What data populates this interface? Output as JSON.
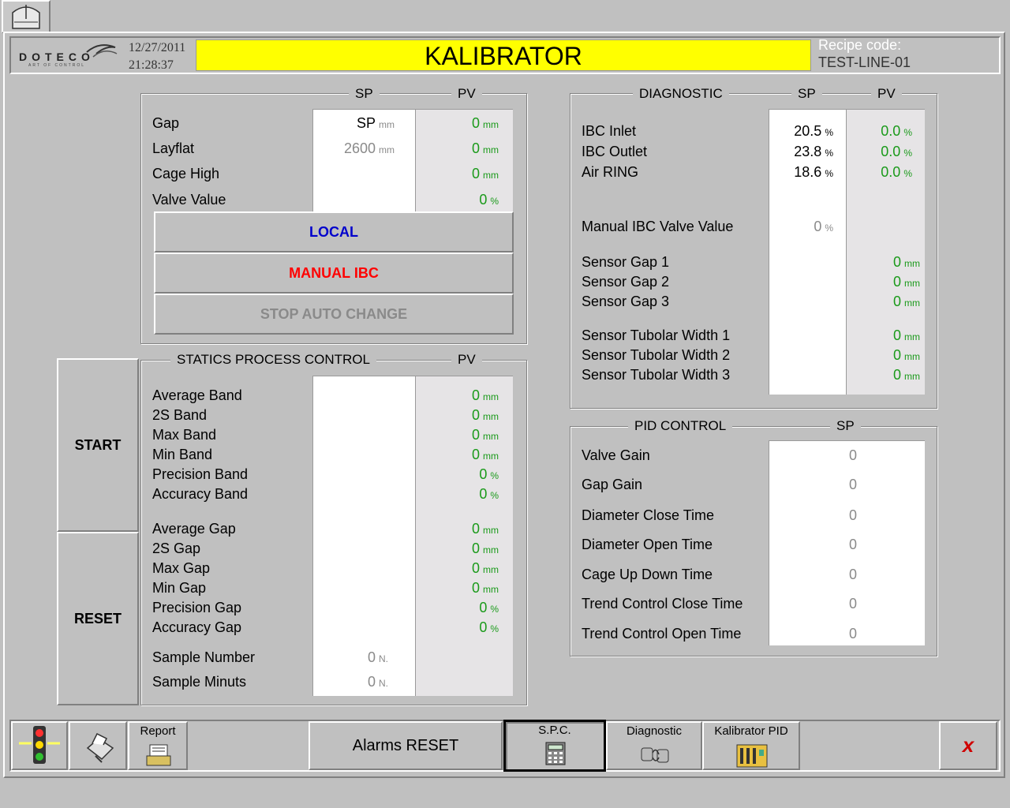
{
  "header": {
    "brand": "DOTECO",
    "brand_tagline": "ART OF CONTROL",
    "date": "12/27/2011",
    "time": "21:28:37",
    "title": "KALIBRATOR",
    "recipe_label": "Recipe code:",
    "recipe_value": "TEST-LINE-01"
  },
  "main": {
    "col_sp": "SP",
    "col_pv": "PV",
    "rows": [
      {
        "label": "Gap",
        "sp": "SP",
        "sp_unit": "mm",
        "pv": "0",
        "pv_unit": "mm"
      },
      {
        "label": "Layflat",
        "sp": "2600",
        "sp_unit": "mm",
        "pv": "0",
        "pv_unit": "mm"
      },
      {
        "label": "Cage High",
        "pv": "0",
        "pv_unit": "mm"
      },
      {
        "label": "Valve Value",
        "pv": "0",
        "pv_unit": "%"
      }
    ],
    "buttons": {
      "local": "LOCAL",
      "manual_ibc": "MANUAL IBC",
      "stop_auto": "STOP AUTO CHANGE"
    }
  },
  "side_buttons": {
    "start": "START",
    "reset": "RESET"
  },
  "statics": {
    "title": "STATICS PROCESS CONTROL",
    "col_pv": "PV",
    "rows": [
      {
        "label": "Average Band",
        "pv": "0",
        "unit": "mm"
      },
      {
        "label": "2S Band",
        "pv": "0",
        "unit": "mm"
      },
      {
        "label": "Max Band",
        "pv": "0",
        "unit": "mm"
      },
      {
        "label": "Min Band",
        "pv": "0",
        "unit": "mm"
      },
      {
        "label": "Precision Band",
        "pv": "0",
        "unit": "%"
      },
      {
        "label": "Accuracy Band",
        "pv": "0",
        "unit": "%"
      },
      {
        "label": "Average Gap",
        "pv": "0",
        "unit": "mm"
      },
      {
        "label": "2S Gap",
        "pv": "0",
        "unit": "mm"
      },
      {
        "label": "Max Gap",
        "pv": "0",
        "unit": "mm"
      },
      {
        "label": "Min Gap",
        "pv": "0",
        "unit": "mm"
      },
      {
        "label": "Precision Gap",
        "pv": "0",
        "unit": "%"
      },
      {
        "label": "Accuracy Gap",
        "pv": "0",
        "unit": "%"
      }
    ],
    "sample_number_label": "Sample Number",
    "sample_number_value": "0",
    "sample_number_unit": "N.",
    "sample_minuts_label": "Sample Minuts",
    "sample_minuts_value": "0",
    "sample_minuts_unit": "N."
  },
  "diagnostic": {
    "title": "DIAGNOSTIC",
    "col_sp": "SP",
    "col_pv": "PV",
    "ibc": [
      {
        "label": "IBC Inlet",
        "sp": "20.5",
        "pv": "0.0",
        "unit": "%"
      },
      {
        "label": "IBC Outlet",
        "sp": "23.8",
        "pv": "0.0",
        "unit": "%"
      },
      {
        "label": "Air RING",
        "sp": "18.6",
        "pv": "0.0",
        "unit": "%"
      }
    ],
    "manual_label": "Manual IBC Valve Value",
    "manual_value": "0",
    "manual_unit": "%",
    "sensors": [
      {
        "label": "Sensor Gap 1",
        "pv": "0",
        "unit": "mm"
      },
      {
        "label": "Sensor Gap 2",
        "pv": "0",
        "unit": "mm"
      },
      {
        "label": "Sensor Gap 3",
        "pv": "0",
        "unit": "mm"
      },
      {
        "label": "Sensor Tubolar Width 1",
        "pv": "0",
        "unit": "mm"
      },
      {
        "label": "Sensor Tubolar Width 2",
        "pv": "0",
        "unit": "mm"
      },
      {
        "label": "Sensor Tubolar Width 3",
        "pv": "0",
        "unit": "mm"
      }
    ]
  },
  "pid": {
    "title": "PID CONTROL",
    "col_sp": "SP",
    "rows": [
      {
        "label": "Valve Gain",
        "sp": "0"
      },
      {
        "label": "Gap Gain",
        "sp": "0"
      },
      {
        "label": "Diameter Close Time",
        "sp": "0"
      },
      {
        "label": "Diameter Open Time",
        "sp": "0"
      },
      {
        "label": "Cage Up Down Time",
        "sp": "0"
      },
      {
        "label": "Trend Control Close Time",
        "sp": "0"
      },
      {
        "label": "Trend Control Open Time",
        "sp": "0"
      }
    ]
  },
  "toolbar": {
    "report": "Report",
    "alarms_reset": "Alarms RESET",
    "spc": "S.P.C.",
    "diagnostic": "Diagnostic",
    "kalibrator_pid": "Kalibrator PID",
    "close": "x"
  },
  "colors": {
    "title_bg": "#ffff00",
    "local": "#0000cc",
    "manual_ibc": "#ff0000",
    "pv_value": "#1a9a1a",
    "disabled": "#8a8a8a"
  }
}
